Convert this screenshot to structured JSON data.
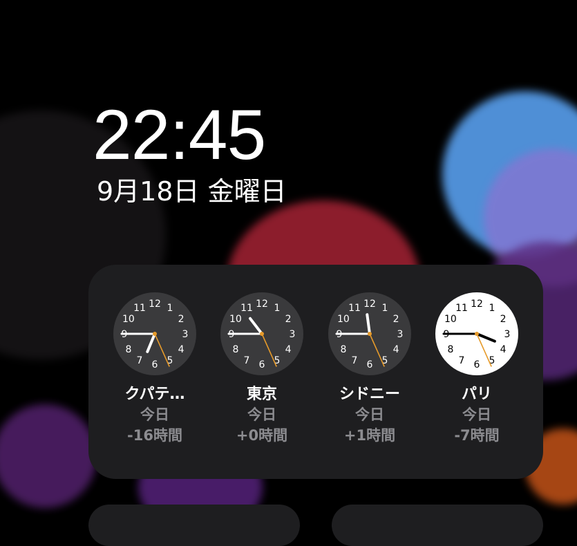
{
  "lockscreen": {
    "time": "22:45",
    "date": "9月18日 金曜日"
  },
  "world_clock_widget": {
    "clocks": [
      {
        "city": "クパテ…",
        "day": "今日",
        "offset": "-16時間",
        "hour": 6,
        "minute": 45,
        "face": "dark"
      },
      {
        "city": "東京",
        "day": "今日",
        "offset": "+0時間",
        "hour": 22,
        "minute": 45,
        "face": "dark"
      },
      {
        "city": "シドニー",
        "day": "今日",
        "offset": "+1時間",
        "hour": 23,
        "minute": 45,
        "face": "dark"
      },
      {
        "city": "パリ",
        "day": "今日",
        "offset": "-7時間",
        "hour": 15,
        "minute": 45,
        "face": "light"
      }
    ]
  },
  "colors": {
    "second_hand": "#e69a2a",
    "widget_bg": "#1e1e20",
    "dark_face": "#3a3a3c",
    "light_face": "#ffffff"
  }
}
